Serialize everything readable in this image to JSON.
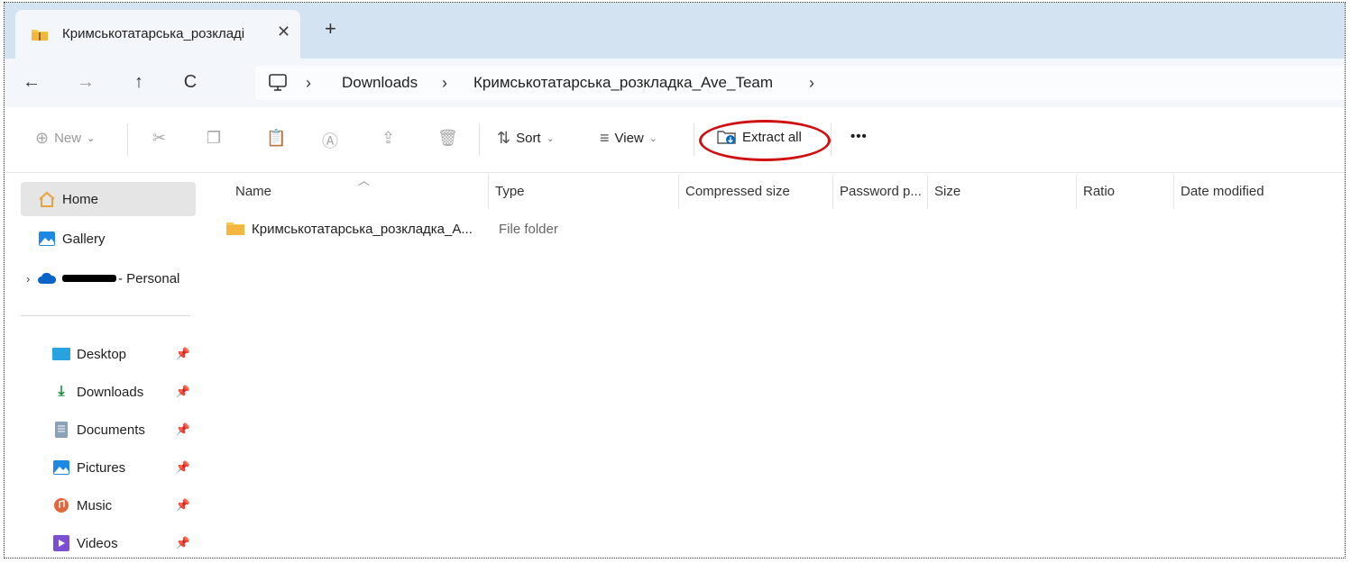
{
  "tab": {
    "title": "Кримськотатарська_розкладі",
    "close_glyph": "✕",
    "new_tab_glyph": "+"
  },
  "nav": {
    "back": "←",
    "forward": "→",
    "up": "↑",
    "refresh": "C"
  },
  "address": {
    "separator": "›",
    "crumbs": [
      "Downloads",
      "Кримськотатарська_розкладка_Ave_Team"
    ]
  },
  "commands": {
    "new_label": "New",
    "sort_label": "Sort",
    "view_label": "View",
    "extract_label": "Extract all",
    "more_label": "•••",
    "chevron": "⌄"
  },
  "sidebar": {
    "home": "Home",
    "gallery": "Gallery",
    "onedrive_suffix": "- Personal",
    "quick_access": [
      {
        "label": "Desktop",
        "icon": "desktop-icon"
      },
      {
        "label": "Downloads",
        "icon": "download-icon"
      },
      {
        "label": "Documents",
        "icon": "document-icon"
      },
      {
        "label": "Pictures",
        "icon": "pictures-icon"
      },
      {
        "label": "Music",
        "icon": "music-icon"
      },
      {
        "label": "Videos",
        "icon": "videos-icon"
      }
    ]
  },
  "columns": [
    "Name",
    "Type",
    "Compressed size",
    "Password p...",
    "Size",
    "Ratio",
    "Date modified"
  ],
  "files": [
    {
      "name": "Кримськотатарська_розкладка_A...",
      "type": "File folder"
    }
  ],
  "colors": {
    "accent": "#0067c0",
    "highlight_ring": "#d01010",
    "folder": "#f7c948"
  }
}
